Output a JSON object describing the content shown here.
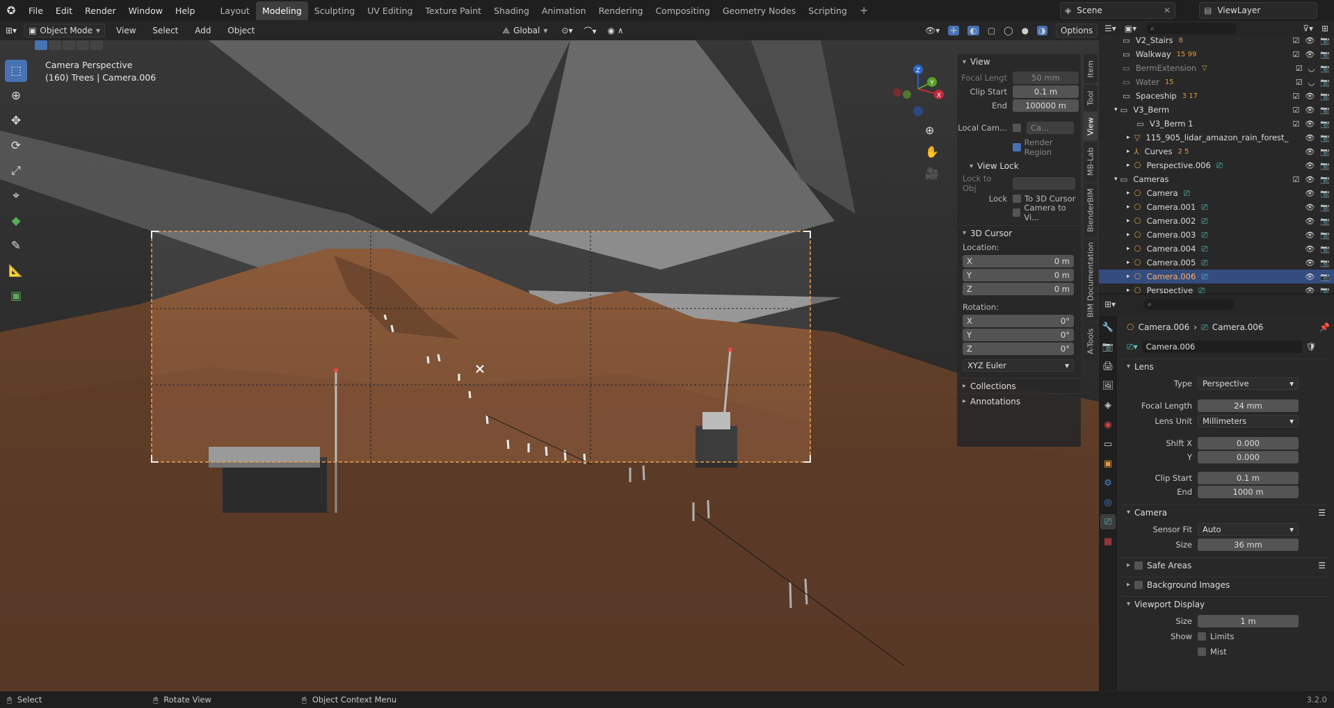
{
  "menubar": {
    "items": [
      "File",
      "Edit",
      "Render",
      "Window",
      "Help"
    ],
    "workspaces": [
      "Layout",
      "Modeling",
      "Sculpting",
      "UV Editing",
      "Texture Paint",
      "Shading",
      "Animation",
      "Rendering",
      "Compositing",
      "Geometry Nodes",
      "Scripting"
    ],
    "active_workspace": "Modeling",
    "scene": "Scene",
    "view_layer": "ViewLayer"
  },
  "viewport_header": {
    "mode": "Object Mode",
    "menus": [
      "View",
      "Select",
      "Add",
      "Object"
    ],
    "orientation": "Global",
    "options": "Options"
  },
  "viewport": {
    "camera_label": "Camera Perspective",
    "object_label": "(160) Trees | Camera.006",
    "gizmo_axes": [
      "X",
      "Y",
      "Z"
    ]
  },
  "npanel": {
    "view_section": "View",
    "focal_label": "Focal Lengt",
    "focal_value": "50 mm",
    "clip_start_label": "Clip Start",
    "clip_start_value": "0.1 m",
    "end_label": "End",
    "end_value": "100000 m",
    "local_cam_label": "Local Cam...",
    "local_cam_value": "Ca...",
    "render_region": "Render Region",
    "view_lock": "View Lock",
    "lock_to_obj": "Lock to Obj",
    "lock_label": "Lock",
    "to_3d_cursor": "To 3D Cursor",
    "camera_to_view": "Camera to Vi...",
    "cursor_section": "3D Cursor",
    "location": "Location:",
    "x": "X",
    "y": "Y",
    "z": "Z",
    "loc_x": "0 m",
    "loc_y": "0 m",
    "loc_z": "0 m",
    "rotation": "Rotation:",
    "rot_x": "0°",
    "rot_y": "0°",
    "rot_z": "0°",
    "rotation_mode": "XYZ Euler",
    "collections": "Collections",
    "annotations": "Annotations"
  },
  "vtabs": [
    "Item",
    "Tool",
    "View",
    "MB-Lab",
    "BlenderBIM",
    "BIM Documentation",
    "A-Tools"
  ],
  "outliner": {
    "items": [
      {
        "name": "V2_Stairs",
        "count": "8"
      },
      {
        "name": "Walkway",
        "count": "15 99"
      },
      {
        "name": "BermExtension",
        "count": ""
      },
      {
        "name": "Water",
        "count": "15"
      },
      {
        "name": "Spaceship",
        "count": "3 17"
      },
      {
        "name": "V3_Berm",
        "count": ""
      },
      {
        "name": "V3_Berm 1",
        "count": ""
      },
      {
        "name": "115_905_lidar_amazon_rain_forest_",
        "count": ""
      },
      {
        "name": "Curves",
        "count": "2 5"
      },
      {
        "name": "Perspective.006",
        "count": ""
      },
      {
        "name": "Cameras",
        "count": ""
      },
      {
        "name": "Camera",
        "count": ""
      },
      {
        "name": "Camera.001",
        "count": ""
      },
      {
        "name": "Camera.002",
        "count": ""
      },
      {
        "name": "Camera.003",
        "count": ""
      },
      {
        "name": "Camera.004",
        "count": ""
      },
      {
        "name": "Camera.005",
        "count": ""
      },
      {
        "name": "Camera.006",
        "count": ""
      },
      {
        "name": "Perspective",
        "count": ""
      }
    ]
  },
  "properties": {
    "breadcrumb_object": "Camera.006",
    "breadcrumb_data": "Camera.006",
    "data_name": "Camera.006",
    "lens_section": "Lens",
    "type_label": "Type",
    "type_value": "Perspective",
    "focal_length_label": "Focal Length",
    "focal_length_value": "24 mm",
    "lens_unit_label": "Lens Unit",
    "lens_unit_value": "Millimeters",
    "shift_x_label": "Shift X",
    "shift_x_value": "0.000",
    "shift_y_label": "Y",
    "shift_y_value": "0.000",
    "clip_start_label": "Clip Start",
    "clip_start_value": "0.1 m",
    "clip_end_label": "End",
    "clip_end_value": "1000 m",
    "camera_section": "Camera",
    "sensor_fit_label": "Sensor Fit",
    "sensor_fit_value": "Auto",
    "size_label": "Size",
    "size_value": "36 mm",
    "safe_areas": "Safe Areas",
    "background_images": "Background Images",
    "viewport_display": "Viewport Display",
    "vd_size_label": "Size",
    "vd_size_value": "1 m",
    "show_label": "Show",
    "limits": "Limits",
    "mist": "Mist"
  },
  "statusbar": {
    "select": "Select",
    "rotate_view": "Rotate View",
    "context_menu": "Object Context Menu",
    "version": "3.2.0"
  },
  "colors": {
    "accent": "#4772b3",
    "selection": "#334d80",
    "camera_frame": "#f0a050",
    "terrain": "#8a5a3a"
  }
}
